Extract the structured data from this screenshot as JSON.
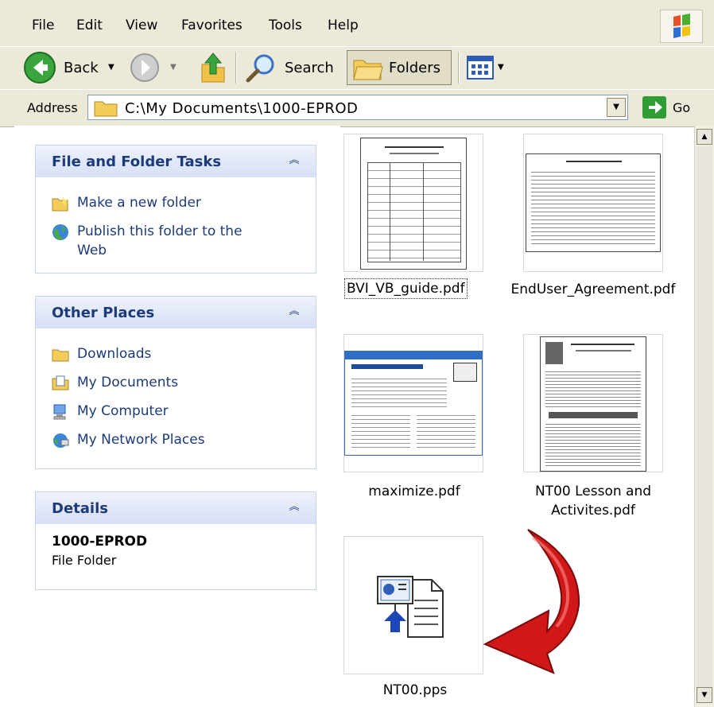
{
  "menu": {
    "items": [
      {
        "label": "File"
      },
      {
        "label": "Edit"
      },
      {
        "label": "View"
      },
      {
        "label": "Favorites"
      },
      {
        "label": "Tools"
      },
      {
        "label": "Help"
      }
    ]
  },
  "toolbar": {
    "back_label": "Back",
    "search_label": "Search",
    "folders_label": "Folders"
  },
  "address": {
    "label": "Address",
    "value": "C:\\My Documents\\1000-EPROD",
    "go_label": "Go"
  },
  "panels": {
    "tasks": {
      "title": "File and Folder Tasks",
      "items": [
        {
          "label": "Make a new folder",
          "icon": "folder-new-icon"
        },
        {
          "label": "Publish this folder to the Web",
          "icon": "globe-icon"
        }
      ]
    },
    "places": {
      "title": "Other Places",
      "items": [
        {
          "label": "Downloads",
          "icon": "folder-icon"
        },
        {
          "label": "My Documents",
          "icon": "documents-icon"
        },
        {
          "label": "My Computer",
          "icon": "computer-icon"
        },
        {
          "label": "My Network Places",
          "icon": "network-icon"
        }
      ]
    },
    "details": {
      "title": "Details",
      "name": "1000-EPROD",
      "type": "File Folder"
    }
  },
  "files": [
    {
      "name": "BVI_VB_guide.pdf",
      "selected": true
    },
    {
      "name": "EndUser_Agreement.pdf",
      "selected": false
    },
    {
      "name": "maximize.pdf",
      "selected": false
    },
    {
      "name": "NT00 Lesson and Activites.pdf",
      "selected": false
    },
    {
      "name": "NT00.pps",
      "selected": false
    }
  ],
  "colors": {
    "chrome": "#ece9d8",
    "panel_title": "#1c3b7a",
    "arrow": "#d01818"
  }
}
